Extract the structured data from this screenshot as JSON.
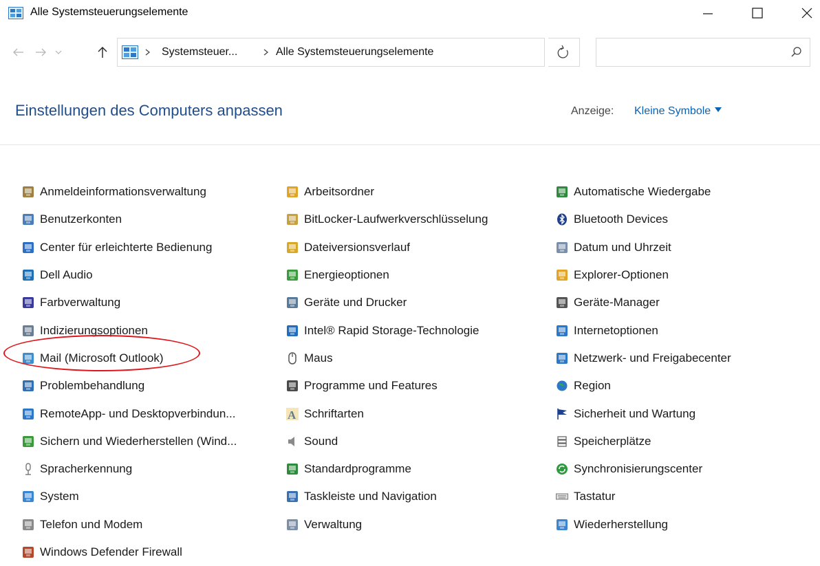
{
  "window": {
    "title": "Alle Systemsteuerungselemente",
    "controls": {
      "minimize": "—",
      "maximize": "☐",
      "close": "✕"
    }
  },
  "address_bar": {
    "breadcrumbs": [
      "Systemsteuer...",
      "Alle Systemsteuerungselemente"
    ]
  },
  "search": {
    "placeholder": "",
    "value": ""
  },
  "header": {
    "title": "Einstellungen des Computers anpassen",
    "view_label": "Anzeige:",
    "view_value": "Kleine Symbole"
  },
  "columns": [
    [
      {
        "label": "Anmeldeinformationsverwaltung",
        "icon": "credential-manager-icon",
        "color": "#a08040"
      },
      {
        "label": "Benutzerkonten",
        "icon": "user-accounts-icon",
        "color": "#4a7ebb"
      },
      {
        "label": "Center für erleichterte Bedienung",
        "icon": "ease-of-access-icon",
        "color": "#2d6fc2"
      },
      {
        "label": "Dell Audio",
        "icon": "dell-audio-icon",
        "color": "#1f6fb5"
      },
      {
        "label": "Farbverwaltung",
        "icon": "color-management-icon",
        "color": "#3a3a9a"
      },
      {
        "label": "Indizierungsoptionen",
        "icon": "indexing-options-icon",
        "color": "#6b7d95"
      },
      {
        "label": "Mail (Microsoft Outlook)",
        "icon": "mail-icon",
        "color": "#3b8fd1"
      },
      {
        "label": "Problembehandlung",
        "icon": "troubleshooting-icon",
        "color": "#2f6fb8"
      },
      {
        "label": "RemoteApp- und Desktopverbindun...",
        "icon": "remoteapp-icon",
        "color": "#2a78c7"
      },
      {
        "label": "Sichern und Wiederherstellen (Wind...",
        "icon": "backup-restore-icon",
        "color": "#3c9a3c"
      },
      {
        "label": "Spracherkennung",
        "icon": "speech-recognition-icon",
        "color": "#777777"
      },
      {
        "label": "System",
        "icon": "system-icon",
        "color": "#3a86d1"
      },
      {
        "label": "Telefon und Modem",
        "icon": "phone-modem-icon",
        "color": "#8a8a8a"
      },
      {
        "label": "Windows Defender Firewall",
        "icon": "firewall-icon",
        "color": "#b5472b"
      }
    ],
    [
      {
        "label": "Arbeitsordner",
        "icon": "work-folders-icon",
        "color": "#e0a526"
      },
      {
        "label": "BitLocker-Laufwerkverschlüsselung",
        "icon": "bitlocker-icon",
        "color": "#c8a040"
      },
      {
        "label": "Dateiversionsverlauf",
        "icon": "file-history-icon",
        "color": "#d8a82a"
      },
      {
        "label": "Energieoptionen",
        "icon": "power-options-icon",
        "color": "#3d9a3d"
      },
      {
        "label": "Geräte und Drucker",
        "icon": "devices-printers-icon",
        "color": "#5b7a98"
      },
      {
        "label": "Intel® Rapid Storage-Technologie",
        "icon": "intel-rst-icon",
        "color": "#1e6fc0"
      },
      {
        "label": "Maus",
        "icon": "mouse-icon",
        "color": "#555555"
      },
      {
        "label": "Programme und Features",
        "icon": "programs-features-icon",
        "color": "#4a4a4a"
      },
      {
        "label": "Schriftarten",
        "icon": "fonts-icon",
        "color": "#e5b830"
      },
      {
        "label": "Sound",
        "icon": "sound-icon",
        "color": "#8a8a8a"
      },
      {
        "label": "Standardprogramme",
        "icon": "default-programs-icon",
        "color": "#2e8b3e"
      },
      {
        "label": "Taskleiste und Navigation",
        "icon": "taskbar-icon",
        "color": "#3a6fb0"
      },
      {
        "label": "Verwaltung",
        "icon": "administrative-tools-icon",
        "color": "#7a8fa8"
      }
    ],
    [
      {
        "label": "Automatische Wiedergabe",
        "icon": "autoplay-icon",
        "color": "#2e8b3e"
      },
      {
        "label": "Bluetooth Devices",
        "icon": "bluetooth-icon",
        "color": "#1f3f8f"
      },
      {
        "label": "Datum und Uhrzeit",
        "icon": "date-time-icon",
        "color": "#7a8fa8"
      },
      {
        "label": "Explorer-Optionen",
        "icon": "explorer-options-icon",
        "color": "#e0a526"
      },
      {
        "label": "Geräte-Manager",
        "icon": "device-manager-icon",
        "color": "#555555"
      },
      {
        "label": "Internetoptionen",
        "icon": "internet-options-icon",
        "color": "#2a78c7"
      },
      {
        "label": "Netzwerk- und Freigabecenter",
        "icon": "network-center-icon",
        "color": "#2a78c7"
      },
      {
        "label": "Region",
        "icon": "region-icon",
        "color": "#2a78c7"
      },
      {
        "label": "Sicherheit und Wartung",
        "icon": "security-maintenance-icon",
        "color": "#1f3f8f"
      },
      {
        "label": "Speicherplätze",
        "icon": "storage-spaces-icon",
        "color": "#666666"
      },
      {
        "label": "Synchronisierungscenter",
        "icon": "sync-center-icon",
        "color": "#2e9a3e"
      },
      {
        "label": "Tastatur",
        "icon": "keyboard-icon",
        "color": "#777777"
      },
      {
        "label": "Wiederherstellung",
        "icon": "recovery-icon",
        "color": "#3a86d1"
      }
    ]
  ],
  "colors": {
    "accent": "#0a62b5",
    "title": "#1f4e8c",
    "annotation": "#e0161b"
  }
}
